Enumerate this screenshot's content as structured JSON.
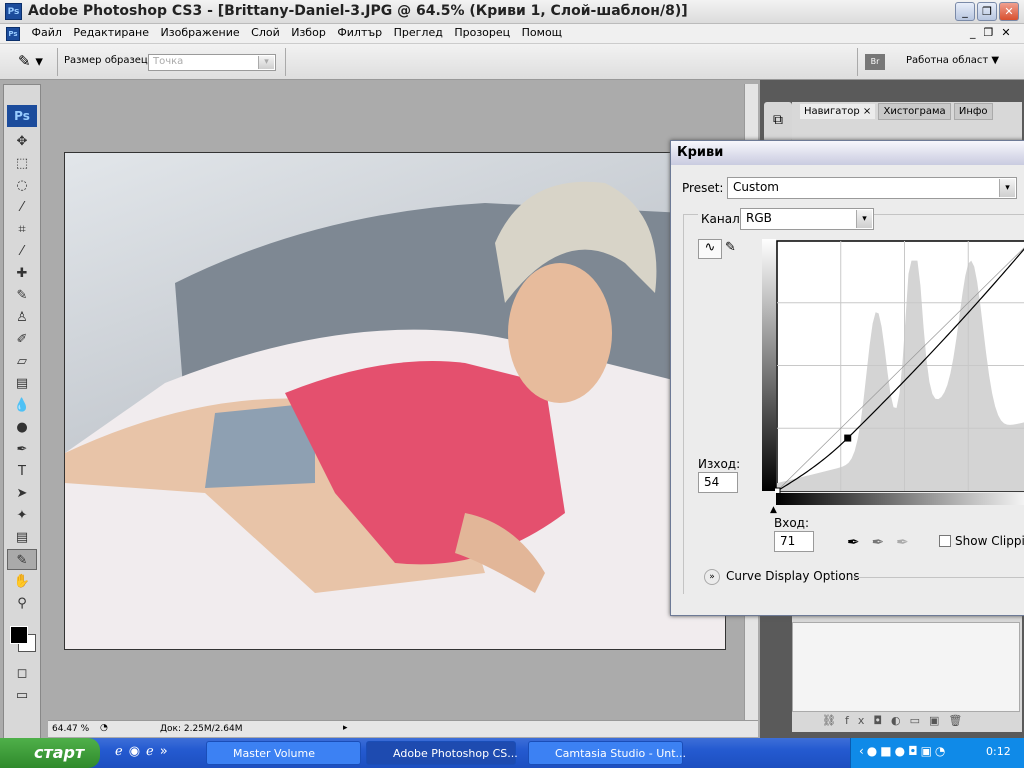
{
  "window": {
    "title": "Adobe Photoshop CS3 - [Brittany-Daniel-3.JPG @ 64.5% (Криви 1, Слой-шаблон/8)]",
    "app_icon": "Ps"
  },
  "menu": [
    "Файл",
    "Редактиране",
    "Изображение",
    "Слой",
    "Избор",
    "Филтър",
    "Преглед",
    "Прозорец",
    "Помощ"
  ],
  "options": {
    "sample_size_label": "Размер образец:",
    "sample_size_value": "Точка",
    "workspace_label": "Работна област"
  },
  "toolbox": {
    "logo": "Ps",
    "tools": [
      "move-icon",
      "marquee-icon",
      "lasso-icon",
      "magic-wand-icon",
      "crop-icon",
      "slice-icon",
      "healing-brush-icon",
      "brush-icon",
      "clone-stamp-icon",
      "history-brush-icon",
      "eraser-icon",
      "gradient-icon",
      "blur-icon",
      "dodge-icon",
      "pen-icon",
      "type-icon",
      "path-select-icon",
      "shape-icon",
      "notes-icon",
      "eyedropper-icon",
      "hand-icon",
      "zoom-icon"
    ]
  },
  "status": {
    "zoom": "64.47 %",
    "doc": "Док: 2.25M/2.64M"
  },
  "panel": {
    "tabs": [
      "Навигатор",
      "Хистограма",
      "Инфо"
    ]
  },
  "curves": {
    "title": "Криви",
    "preset_label": "Preset:",
    "preset_value": "Custom",
    "channel_label": "Канал:",
    "channel_value": "RGB",
    "output_label": "Изход:",
    "output_value": "54",
    "input_label": "Вход:",
    "input_value": "71",
    "show_clipping": "Show Clipping",
    "show_clipping_checked": false,
    "display_options": "Curve Display Options",
    "points": [
      [
        0,
        0
      ],
      [
        71,
        54
      ],
      [
        255,
        255
      ]
    ]
  },
  "taskbar": {
    "start": "старт",
    "items": [
      "Master Volume",
      "Adobe Photoshop CS...",
      "Camtasia Studio - Unt..."
    ],
    "clock": "0:12"
  }
}
